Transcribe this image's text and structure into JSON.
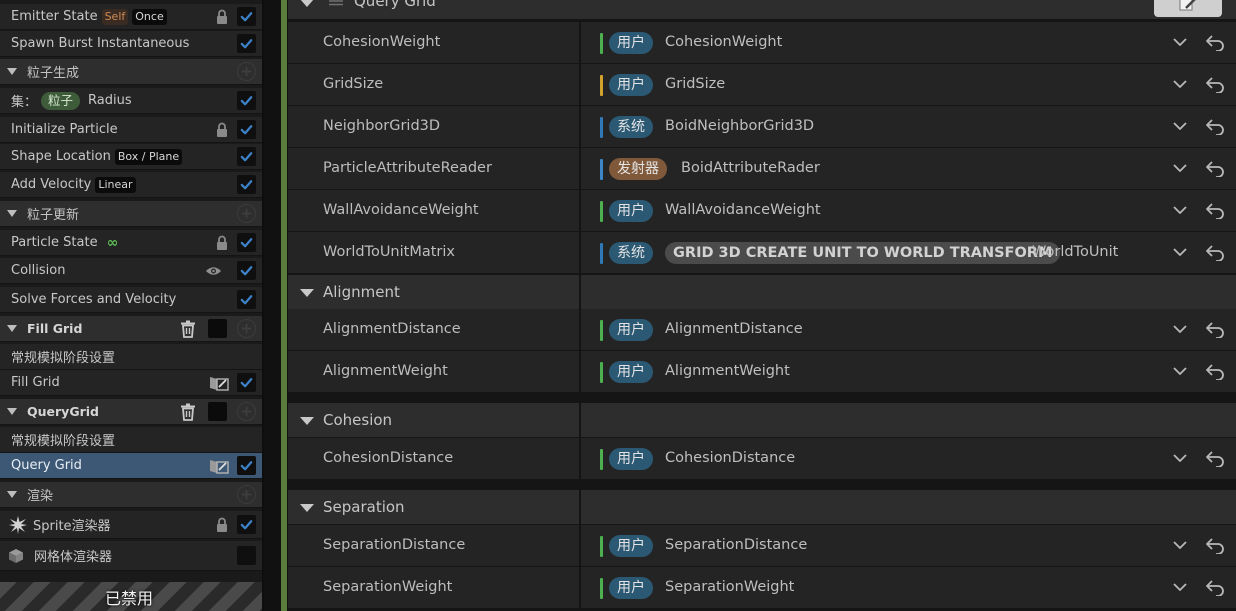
{
  "stack": {
    "emitter_state": {
      "label": "Emitter State",
      "badge1": "Self",
      "badge2": "Once"
    },
    "spawn_burst": {
      "label": "Spawn Burst Instantaneous"
    },
    "particle_spawn_group": {
      "label": "粒子生成"
    },
    "set_radius": {
      "prefix": "集：",
      "pill": "粒子",
      "value": "Radius"
    },
    "initialize_particle": {
      "label": "Initialize Particle"
    },
    "shape_location": {
      "label": "Shape Location",
      "badge": "Box / Plane"
    },
    "add_velocity": {
      "label": "Add Velocity",
      "badge": "Linear"
    },
    "particle_update_group": {
      "label": "粒子更新"
    },
    "particle_state": {
      "label": "Particle State",
      "icon": "infinity-icon",
      "glyph": "∞"
    },
    "collision": {
      "label": "Collision"
    },
    "solve_forces": {
      "label": "Solve Forces and Velocity"
    },
    "fill_grid_group": {
      "label": "Fill Grid"
    },
    "fill_grid_settings": {
      "label": "常规模拟阶段设置"
    },
    "fill_grid_item": {
      "label": "Fill Grid"
    },
    "query_grid_group": {
      "label": "QueryGrid"
    },
    "query_grid_settings": {
      "label": "常规模拟阶段设置"
    },
    "query_grid_item": {
      "label": "Query Grid"
    },
    "render_group": {
      "label": "渲染"
    },
    "sprite_renderer": {
      "label": "Sprite渲染器"
    },
    "mesh_renderer": {
      "label": "网格体渲染器"
    },
    "disabled_label": "已禁用"
  },
  "details": {
    "section_query": "Query Grid",
    "colors": {
      "user_bar": "#4caf50",
      "sys_bar": "#2f79b8",
      "emit_bar": "#3d87c9",
      "grid_bar": "#d2a32c"
    },
    "query_rows": [
      {
        "name": "CohesionWeight",
        "scope": "用户",
        "value": "CohesionWeight"
      },
      {
        "name": "GridSize",
        "scope": "用户",
        "value": "GridSize"
      },
      {
        "name": "NeighborGrid3D",
        "scope": "系统",
        "value": "BoidNeighborGrid3D"
      },
      {
        "name": "ParticleAttributeReader",
        "scope": "发射器",
        "value": "BoidAttributeRader"
      },
      {
        "name": "WallAvoidanceWeight",
        "scope": "用户",
        "value": "WallAvoidanceWeight"
      },
      {
        "name": "WorldToUnitMatrix",
        "scope": "系统",
        "function": "GRID 3D CREATE UNIT TO WORLD TRANSFORM",
        "value": "WorldToUnit"
      }
    ],
    "section_alignment": "Alignment",
    "alignment_rows": [
      {
        "name": "AlignmentDistance",
        "scope": "用户",
        "value": "AlignmentDistance"
      },
      {
        "name": "AlignmentWeight",
        "scope": "用户",
        "value": "AlignmentWeight"
      }
    ],
    "section_cohesion": "Cohesion",
    "cohesion_rows": [
      {
        "name": "CohesionDistance",
        "scope": "用户",
        "value": "CohesionDistance"
      }
    ],
    "section_separation": "Separation",
    "separation_rows": [
      {
        "name": "SeparationDistance",
        "scope": "用户",
        "value": "SeparationDistance"
      },
      {
        "name": "SeparationWeight",
        "scope": "用户",
        "value": "SeparationWeight"
      }
    ]
  }
}
